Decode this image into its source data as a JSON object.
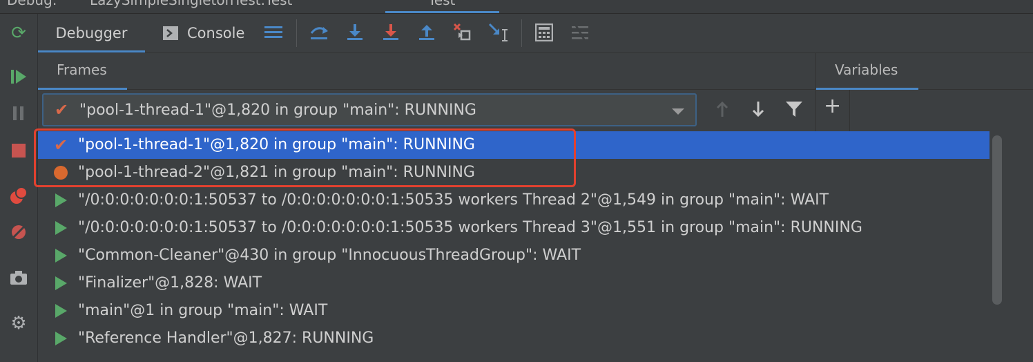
{
  "window": {
    "tabs": [
      {
        "label": "Debug:"
      },
      {
        "label": "LazySimpleSingletonTest.Test"
      },
      {
        "label": "Test"
      }
    ]
  },
  "toolbar": {
    "tabs": [
      {
        "label": "Debugger",
        "active": true
      },
      {
        "label": "Console",
        "active": false
      }
    ],
    "icons": [
      "layout-icon",
      "show-execution-point-icon",
      "step-over-icon",
      "step-into-icon",
      "force-step-into-icon",
      "step-out-icon",
      "drop-frame-icon",
      "run-to-cursor-icon",
      "evaluate-expression-icon",
      "trace-icon"
    ]
  },
  "frames_panel": {
    "title": "Frames",
    "selected_thread": "\"pool-1-thread-1\"@1,820 in group \"main\": RUNNING"
  },
  "variables_panel": {
    "title": "Variables",
    "add_icon": "+"
  },
  "thread_list": [
    {
      "label": "\"pool-1-thread-1\"@1,820 in group \"main\": RUNNING",
      "icon": "check-icon",
      "selected": true
    },
    {
      "label": "\"pool-1-thread-2\"@1,821 in group \"main\": RUNNING",
      "icon": "breakpoint-dot-icon",
      "selected": false
    },
    {
      "label": "\"/0:0:0:0:0:0:0:1:50537 to /0:0:0:0:0:0:0:1:50535 workers Thread 2\"@1,549 in group \"main\": WAIT",
      "icon": "play-icon",
      "selected": false
    },
    {
      "label": "\"/0:0:0:0:0:0:0:1:50537 to /0:0:0:0:0:0:0:1:50535 workers Thread 3\"@1,551 in group \"main\": RUNNING",
      "icon": "play-icon",
      "selected": false
    },
    {
      "label": "\"Common-Cleaner\"@430 in group \"InnocuousThreadGroup\": WAIT",
      "icon": "play-icon",
      "selected": false
    },
    {
      "label": "\"Finalizer\"@1,828: WAIT",
      "icon": "play-icon",
      "selected": false
    },
    {
      "label": "\"main\"@1 in group \"main\": WAIT",
      "icon": "play-icon",
      "selected": false
    },
    {
      "label": "\"Reference Handler\"@1,827: RUNNING",
      "icon": "play-icon",
      "selected": false
    }
  ],
  "colors": {
    "background": "#3c3f41",
    "selection": "#2f65ca",
    "accent": "#4a88c7",
    "highlight_box": "#e2412f",
    "running_green": "#59a869",
    "breakpoint_orange": "#d9692f"
  }
}
